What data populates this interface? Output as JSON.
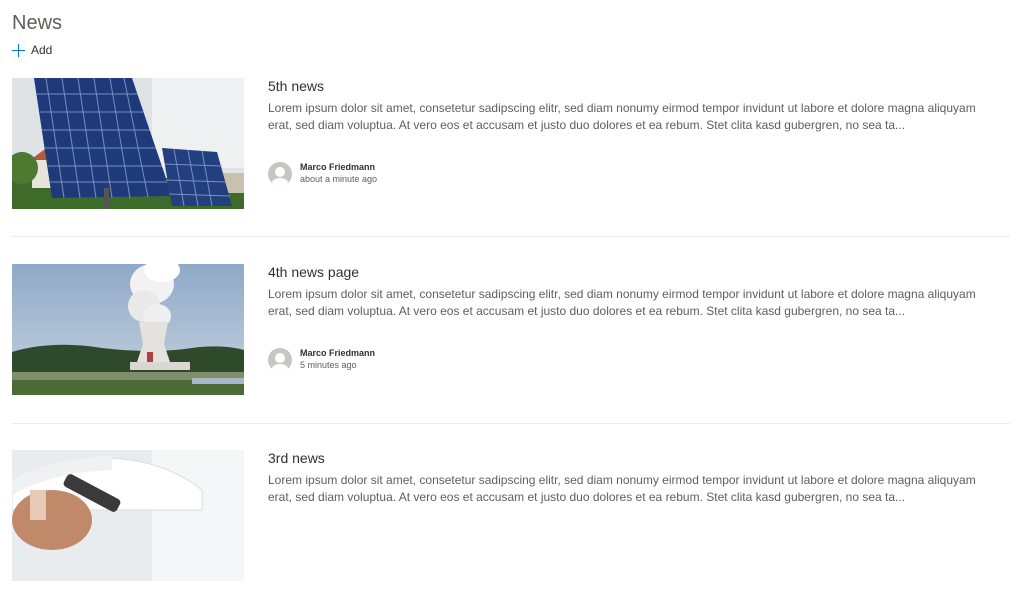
{
  "header": {
    "title": "News",
    "add_label": "Add"
  },
  "news": [
    {
      "title": "5th news",
      "description": "Lorem ipsum dolor sit amet, consetetur sadipscing elitr, sed diam nonumy eirmod tempor invidunt ut labore et dolore magna aliquyam erat, sed diam voluptua. At vero eos et accusam et justo duo dolores et ea rebum. Stet clita kasd gubergren, no sea ta...",
      "author": "Marco Friedmann",
      "time": "about a minute ago",
      "image": "solar-panels"
    },
    {
      "title": "4th news page",
      "description": "Lorem ipsum dolor sit amet, consetetur sadipscing elitr, sed diam nonumy eirmod tempor invidunt ut labore et dolore magna aliquyam erat, sed diam voluptua. At vero eos et accusam et justo duo dolores et ea rebum. Stet clita kasd gubergren, no sea ta...",
      "author": "Marco Friedmann",
      "time": "5 minutes ago",
      "image": "cooling-tower"
    },
    {
      "title": "3rd news",
      "description": "Lorem ipsum dolor sit amet, consetetur sadipscing elitr, sed diam nonumy eirmod tempor invidunt ut labore et dolore magna aliquyam erat, sed diam voluptua. At vero eos et accusam et justo duo dolores et ea rebum. Stet clita kasd gubergren, no sea ta...",
      "image": "worker-helmet"
    }
  ]
}
